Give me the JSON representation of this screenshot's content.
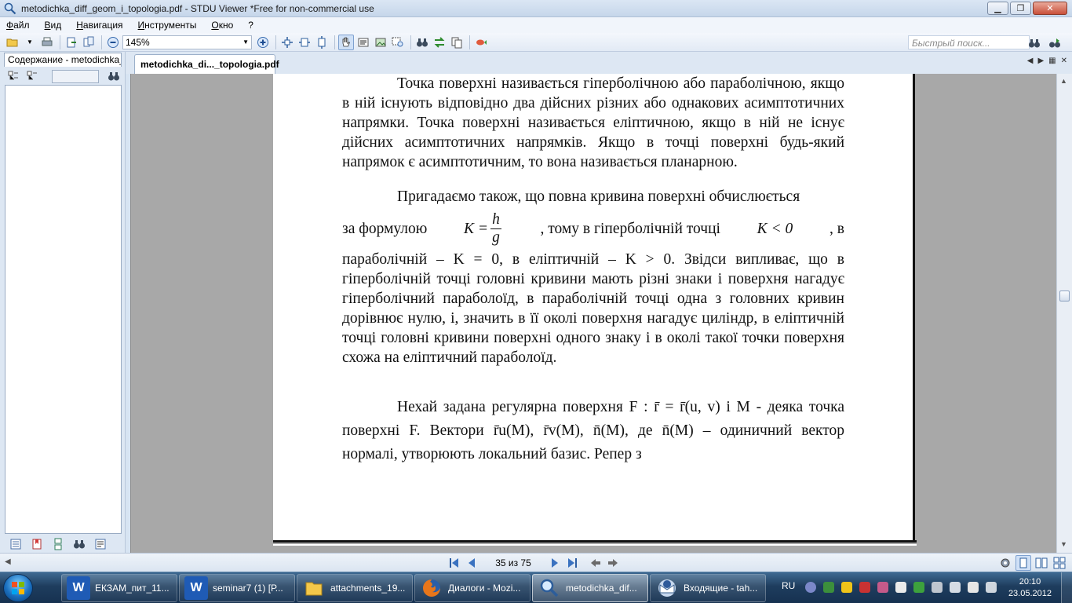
{
  "window": {
    "title": "metodichka_diff_geom_i_topologia.pdf - STDU Viewer *Free for non-commercial use",
    "controls": [
      "minimize",
      "maximize",
      "close"
    ]
  },
  "menu": [
    "Файл",
    "Вид",
    "Навигация",
    "Инструменты",
    "Окно",
    "?"
  ],
  "toolbar": {
    "zoom": "145%",
    "search_placeholder": "Быстрый поиск..."
  },
  "left_panel": {
    "tab_label": "Содержание - metodichka_diff_geom_i_topologia.pdf"
  },
  "document": {
    "tab_label": "metodichka_di..._topologia.pdf",
    "para1": "Точка поверхні називається гіперболічною або параболічною, якщо в ній існують відповідно два дійсних різних або однакових асимптотичних напрямки. Точка поверхні називається еліптичною, якщо в ній не існує дійсних асимптотичних напрямків. Якщо в точці поверхні будь-який напрямок є асимптотичним, то вона називається планарною.",
    "para2_line1": "Пригадаємо також, що повна кривина поверхні обчислюється",
    "para2_a": "за формулою",
    "para2_k": "K =",
    "para2_num": "h",
    "para2_den": "g",
    "para2_b": ", тому в гіперболічній точці",
    "para2_klt": "K < 0",
    "para2_c": ", в",
    "para2_rest": "параболічній – K = 0, в еліптичній – K > 0. Звідси випливає, що в гіперболічній точці головні кривини мають різні знаки і поверхня нагадує гіперболічний параболоїд, в параболічній точці одна з головних кривин дорівнює нулю, і, значить в її околі поверхня нагадує циліндр, в еліптичній точці головні кривини поверхні одного знаку і в околі такої точки поверхня схожа на еліптичний параболоїд.",
    "para3": "Нехай задана регулярна поверхня F : r̄ = r̄(u, v) і M - деяка точка поверхні F. Вектори r̄u(M), r̄v(M), n̄(M), де n̄(M) – одиничний вектор нормалі, утворюють локальний базис. Репер з"
  },
  "statusbar": {
    "page_indicator": "35 из 75"
  },
  "taskbar": {
    "items": [
      {
        "label": "ЕКЗАМ_пит_11...",
        "icon": "word-icon"
      },
      {
        "label": "seminar7 (1) [Р...",
        "icon": "word-icon"
      },
      {
        "label": "attachments_19...",
        "icon": "folder-icon"
      },
      {
        "label": "Диалоги - Mozi...",
        "icon": "firefox-icon"
      },
      {
        "label": "metodichka_dif...",
        "icon": "stdu-viewer-icon"
      },
      {
        "label": "Входящие - tah...",
        "icon": "thunderbird-icon"
      }
    ],
    "language": "RU",
    "time": "20:10",
    "date": "23.05.2012"
  },
  "colors": {
    "accent": "#1e3d5e",
    "page_background": "#ffffff",
    "viewer_background": "#a8a8a8"
  }
}
